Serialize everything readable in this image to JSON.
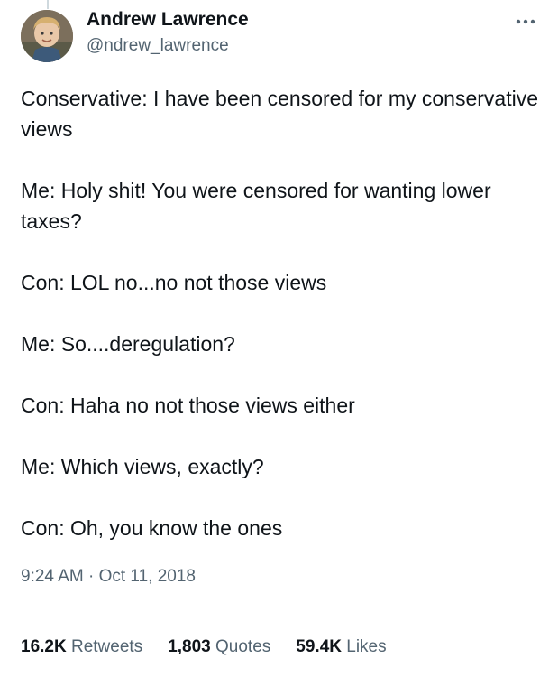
{
  "author": {
    "name": "Andrew Lawrence",
    "handle": "@ndrew_lawrence",
    "avatar_icon": "profile-photo"
  },
  "more_icon": "more-horizontal-icon",
  "tweet": {
    "paragraphs": [
      "Conservative: I have been censored for my conservative views",
      "Me: Holy shit! You were censored for wanting lower taxes?",
      "Con: LOL no...no not those views",
      "Me: So....deregulation?",
      "Con: Haha no not those views either",
      "Me: Which views, exactly?",
      "Con: Oh, you know the ones"
    ],
    "timestamp": "9:24 AM · Oct 11, 2018"
  },
  "stats": {
    "retweets": {
      "count": "16.2K",
      "label": "Retweets"
    },
    "quotes": {
      "count": "1,803",
      "label": "Quotes"
    },
    "likes": {
      "count": "59.4K",
      "label": "Likes"
    }
  },
  "colors": {
    "primary_text": "#0f1419",
    "secondary_text": "#536471",
    "divider": "#eff3f4"
  }
}
